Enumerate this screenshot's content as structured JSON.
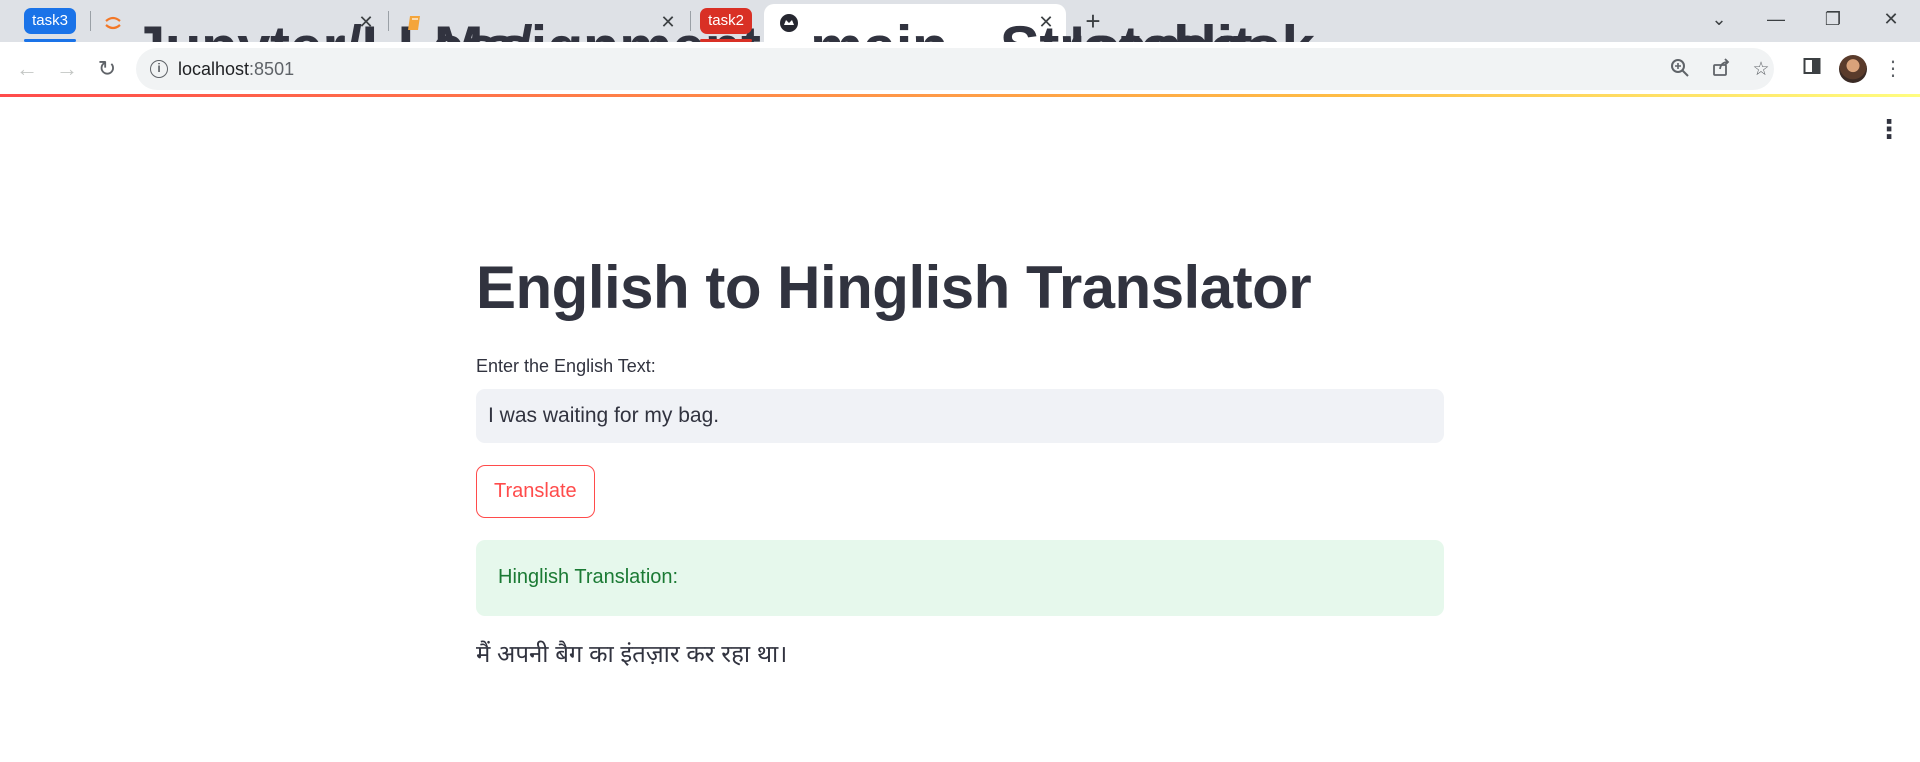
{
  "browser": {
    "tab_groups": [
      {
        "label": "task3",
        "color": "#1a73e8"
      },
      {
        "label": "task2",
        "color": "#d93025"
      }
    ],
    "tabs": [
      {
        "title": "Jupyter/LLMs/",
        "icon": "jupyter-icon"
      },
      {
        "title": "assignment - Jupyter Notebook",
        "icon": "notebook-icon"
      },
      {
        "title": "main · Streamlit",
        "icon": "streamlit-icon",
        "active": true
      }
    ],
    "url_host": "localhost",
    "url_port": ":8501"
  },
  "app": {
    "title": "English to Hinglish Translator",
    "input_label": "Enter the English Text:",
    "input_value": "I was waiting for my bag.",
    "button_label": "Translate",
    "success_message": "Hinglish Translation:",
    "result_text": "मैं अपनी बैग का इंतज़ार कर रहा था।",
    "accent_color": "#ff4b4b",
    "success_bg": "#e6f8ec"
  }
}
